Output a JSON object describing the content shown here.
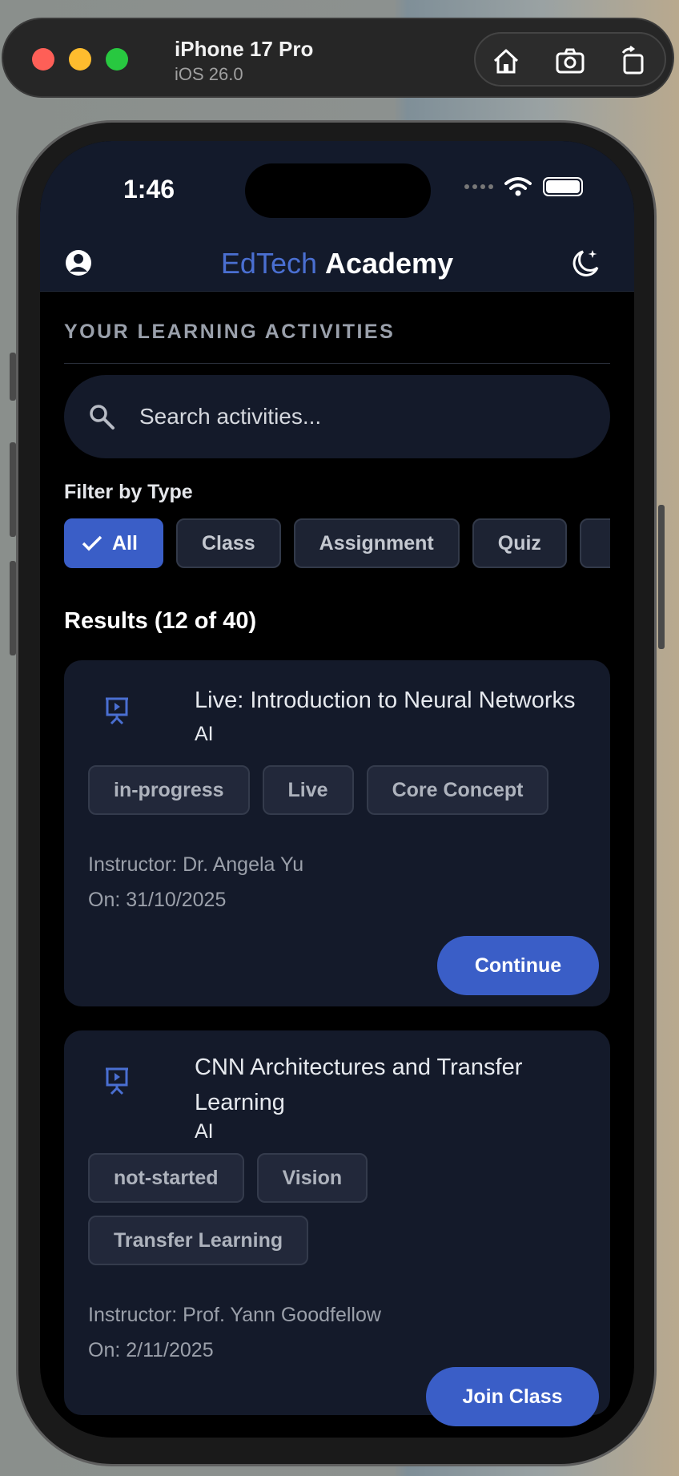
{
  "simulator": {
    "device": "iPhone 17 Pro",
    "os": "iOS 26.0",
    "tools": [
      "home-icon",
      "screenshot-icon",
      "rotate-icon"
    ]
  },
  "status_bar": {
    "time": "1:46"
  },
  "header": {
    "brand_part1": "EdTech",
    "brand_part2": "Academy",
    "left_icon": "account-icon",
    "right_icon": "theme-toggle-icon"
  },
  "section": {
    "title": "YOUR LEARNING ACTIVITIES"
  },
  "search": {
    "placeholder": "Search activities..."
  },
  "filter": {
    "label": "Filter by Type",
    "chips": [
      {
        "label": "All",
        "active": true
      },
      {
        "label": "Class",
        "active": false
      },
      {
        "label": "Assignment",
        "active": false
      },
      {
        "label": "Quiz",
        "active": false
      }
    ]
  },
  "results": {
    "label": "Results (12 of 40)"
  },
  "cards": [
    {
      "title": "Live: Introduction to Neural Networks",
      "category": "AI",
      "tags": [
        "in-progress",
        "Live",
        "Core Concept"
      ],
      "instructor": "Instructor: Dr. Angela Yu",
      "date": "On: 31/10/2025",
      "action": "Continue",
      "icon": "presentation-icon"
    },
    {
      "title": "CNN Architectures and Transfer Learning",
      "category": "AI",
      "tags": [
        "not-started",
        "Vision",
        "Transfer Learning"
      ],
      "instructor": "Instructor: Prof. Yann Goodfellow",
      "date": "On: 2/11/2025",
      "action": "Join Class",
      "icon": "presentation-icon"
    }
  ],
  "colors": {
    "accent": "#3a5ec7",
    "brand_blue": "#4a6fd1",
    "card_bg": "#141a2a",
    "header_bg": "#131a2b"
  }
}
